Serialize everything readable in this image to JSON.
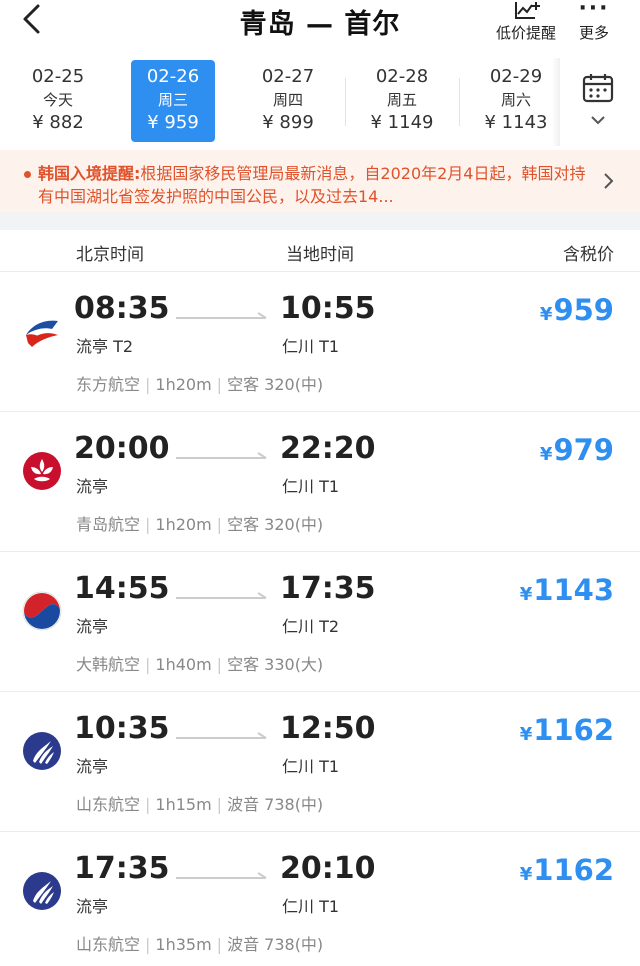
{
  "header": {
    "title": "青岛 — 首尔",
    "low_price_label": "低价提醒",
    "more_label": "更多"
  },
  "dates": [
    {
      "date": "02-25",
      "weekday": "今天",
      "price": "¥ 882"
    },
    {
      "date": "02-26",
      "weekday": "周三",
      "price": "¥ 959",
      "active": true
    },
    {
      "date": "02-27",
      "weekday": "周四",
      "price": "¥ 899"
    },
    {
      "date": "02-28",
      "weekday": "周五",
      "price": "¥ 1149"
    },
    {
      "date": "02-29",
      "weekday": "周六",
      "price": "¥ 1143"
    }
  ],
  "notice": {
    "title": "韩国入境提醒:",
    "body": "根据国家移民管理局最新消息，自2020年2月4日起，韩国对持有中国湖北省签发护照的中国公民，以及过去14..."
  },
  "columns": {
    "beijing_time": "北京时间",
    "local_time": "当地时间",
    "price_incl_tax": "含税价"
  },
  "flights": [
    {
      "dep_time": "08:35",
      "dep_airport": "流亭 T2",
      "arr_time": "10:55",
      "arr_airport": "仁川 T1",
      "currency": "¥",
      "price": "959",
      "airline": "东方航空",
      "duration": "1h20m",
      "aircraft": "空客 320(中)",
      "logo": "china-eastern-logo"
    },
    {
      "dep_time": "20:00",
      "dep_airport": "流亭",
      "arr_time": "22:20",
      "arr_airport": "仁川 T1",
      "currency": "¥",
      "price": "979",
      "airline": "青岛航空",
      "duration": "1h20m",
      "aircraft": "空客 320(中)",
      "logo": "qingdao-airlines-logo"
    },
    {
      "dep_time": "14:55",
      "dep_airport": "流亭",
      "arr_time": "17:35",
      "arr_airport": "仁川 T2",
      "currency": "¥",
      "price": "1143",
      "airline": "大韩航空",
      "duration": "1h40m",
      "aircraft": "空客 330(大)",
      "logo": "korean-air-logo"
    },
    {
      "dep_time": "10:35",
      "dep_airport": "流亭",
      "arr_time": "12:50",
      "arr_airport": "仁川 T1",
      "currency": "¥",
      "price": "1162",
      "airline": "山东航空",
      "duration": "1h15m",
      "aircraft": "波音 738(中)",
      "logo": "shandong-airlines-logo"
    },
    {
      "dep_time": "17:35",
      "dep_airport": "流亭",
      "arr_time": "20:10",
      "arr_airport": "仁川 T1",
      "currency": "¥",
      "price": "1162",
      "airline": "山东航空",
      "duration": "1h35m",
      "aircraft": "波音 738(中)",
      "logo": "shandong-airlines-logo"
    }
  ],
  "colors": {
    "accent": "#2f8ff0",
    "notice_text": "#e0522b",
    "notice_bg": "#fdf3ec"
  }
}
